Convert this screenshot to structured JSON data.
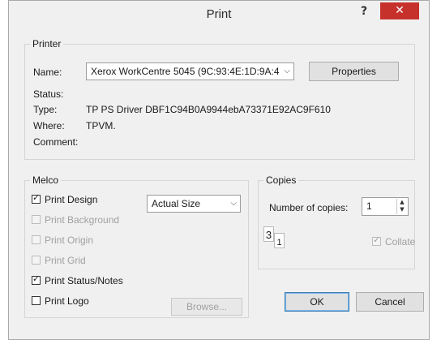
{
  "window": {
    "title": "Print",
    "help_glyph": "?",
    "close_glyph": "✕"
  },
  "printer": {
    "group_label": "Printer",
    "name_label": "Name:",
    "name_value": "Xerox WorkCentre 5045 (9C:93:4E:1D:9A:4",
    "properties_label": "Properties",
    "status_label": "Status:",
    "status_value": "",
    "type_label": "Type:",
    "type_value": "TP PS Driver DBF1C94B0A9944ebA73371E92AC9F610",
    "where_label": "Where:",
    "where_value": "TPVM.",
    "comment_label": "Comment:",
    "comment_value": ""
  },
  "melco": {
    "group_label": "Melco",
    "options": [
      {
        "label": "Print Design",
        "checked": true,
        "enabled": true
      },
      {
        "label": "Print Background",
        "checked": false,
        "enabled": false
      },
      {
        "label": "Print Origin",
        "checked": false,
        "enabled": false
      },
      {
        "label": "Print Grid",
        "checked": false,
        "enabled": false
      },
      {
        "label": "Print Status/Notes",
        "checked": true,
        "enabled": true
      },
      {
        "label": "Print Logo",
        "checked": false,
        "enabled": true
      }
    ],
    "size_value": "Actual Size",
    "browse_label": "Browse..."
  },
  "copies": {
    "group_label": "Copies",
    "number_label": "Number of copies:",
    "number_value": "1",
    "collate_label": "Collate",
    "collate_checked": true,
    "collate_enabled": false,
    "page_icon_front": "3",
    "page_icon_back": "1"
  },
  "buttons": {
    "ok_label": "OK",
    "cancel_label": "Cancel"
  },
  "colors": {
    "close_button": "#c7312b",
    "dialog_bg": "#f0f0f0"
  }
}
